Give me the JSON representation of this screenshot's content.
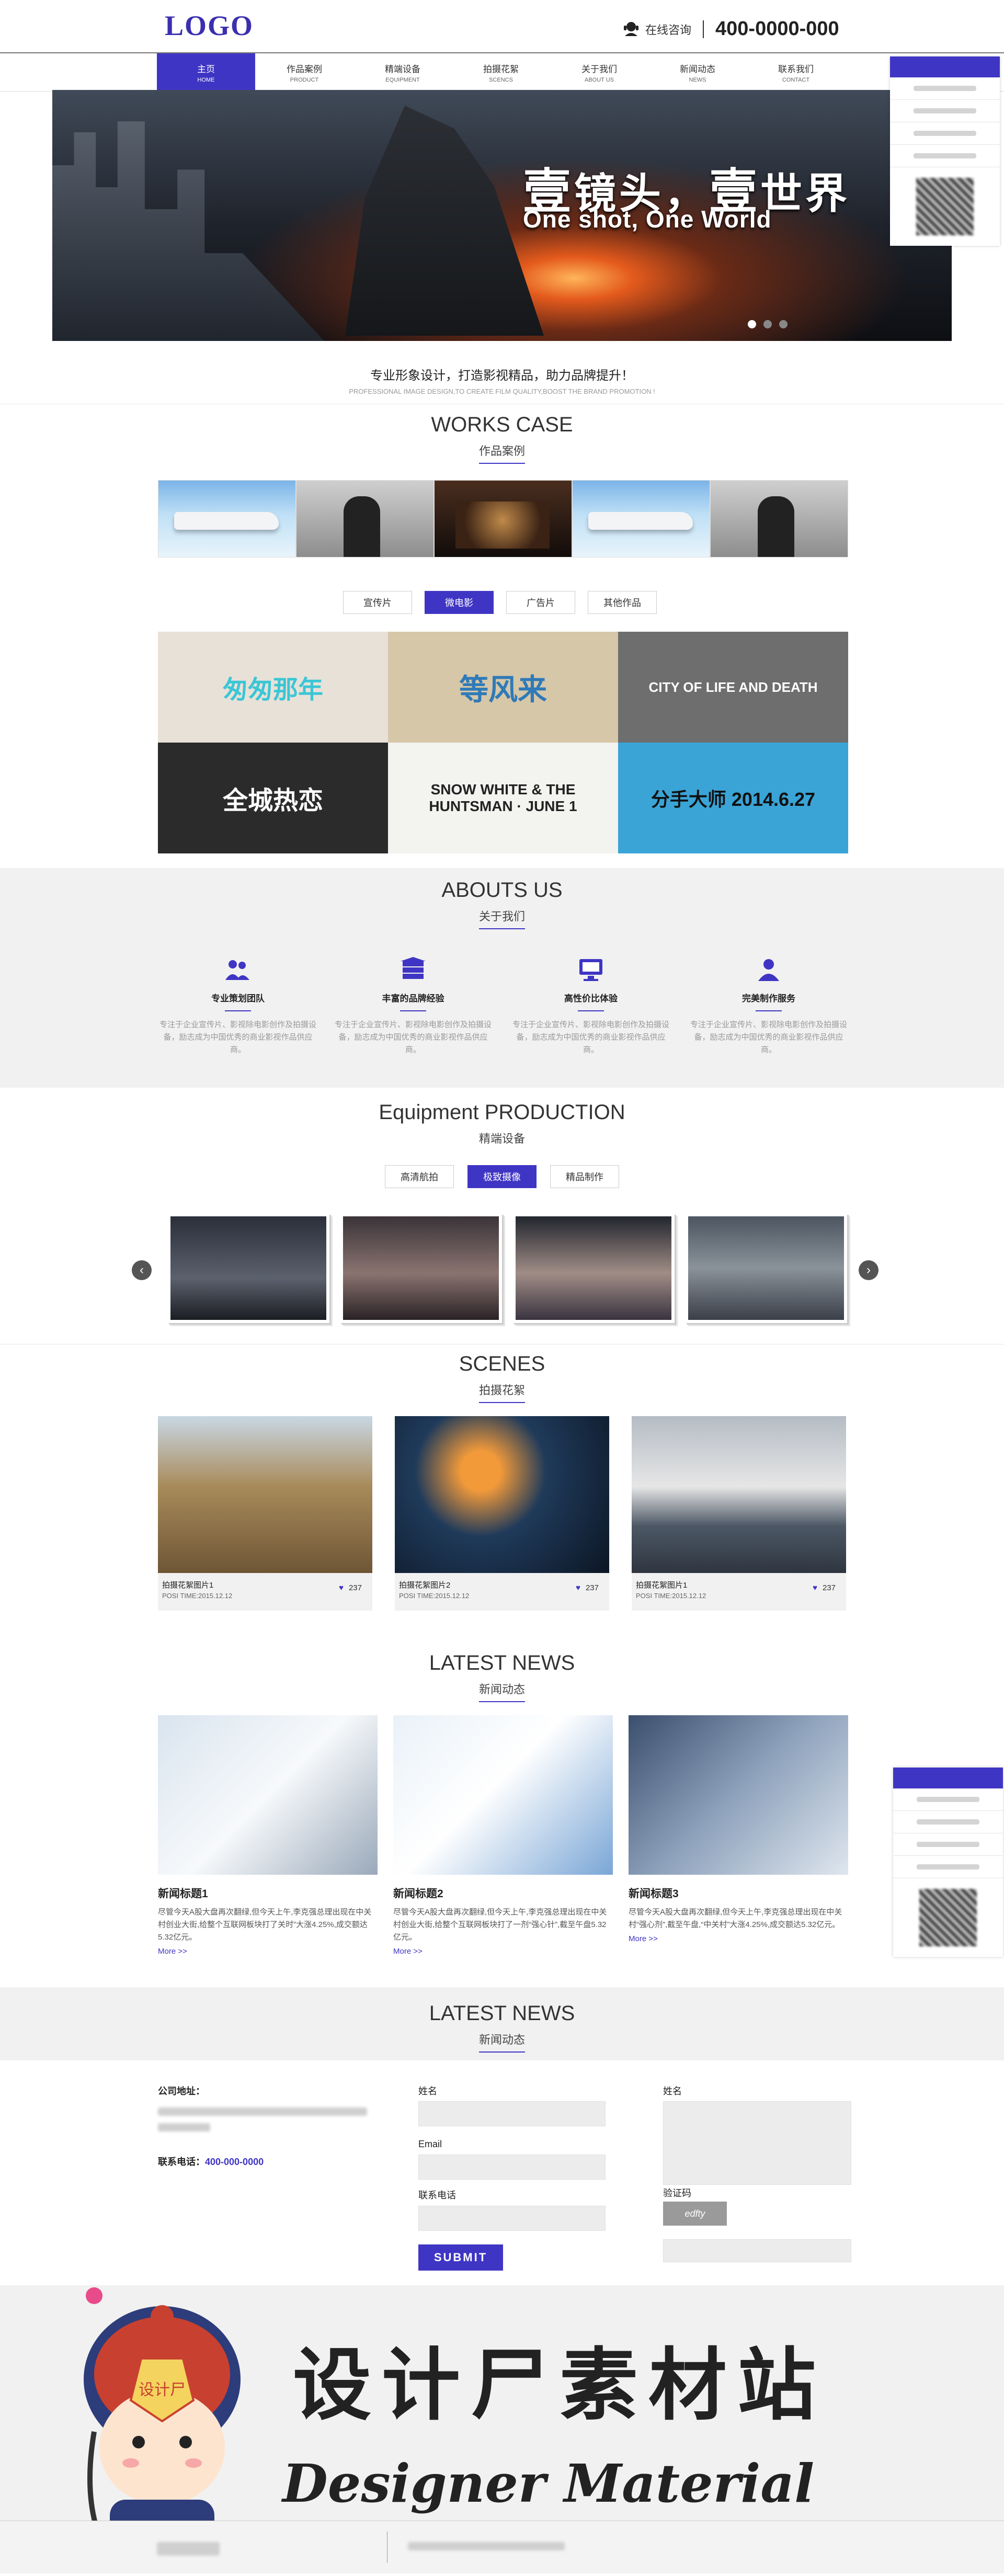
{
  "header": {
    "logo": "LOGO",
    "hotline_label": "在线咨询",
    "hotline_number": "400-0000-000"
  },
  "nav": [
    {
      "cn": "主页",
      "en": "HOME",
      "active": true
    },
    {
      "cn": "作品案例",
      "en": "PRODUCT"
    },
    {
      "cn": "精端设备",
      "en": "EQUIPMENT"
    },
    {
      "cn": "拍摄花絮",
      "en": "SCENCS"
    },
    {
      "cn": "关于我们",
      "en": "ABOUT US"
    },
    {
      "cn": "新闻动态",
      "en": "NEWS"
    },
    {
      "cn": "联系我们",
      "en": "CONTACT"
    }
  ],
  "banner": {
    "title_cn_a": "壹",
    "title_cn_b": "镜头，",
    "title_cn_c": "壹",
    "title_cn_d": "世界",
    "title_en": "One shot, One World"
  },
  "slogan": {
    "cn": "专业形象设计，打造影视精品，助力品牌提升！",
    "en": "PROFESSIONAL IMAGE DESIGN,TO CREATE FILM QUALITY,BOOST THE BRAND PROMOTION !"
  },
  "works": {
    "title": "WORKS CASE",
    "subtitle": "作品案例",
    "filters": [
      "宣传片",
      "微电影",
      "广告片",
      "其他作品"
    ],
    "active_filter": 1,
    "posters": [
      {
        "text": "匆匆那年",
        "bg": "#e8e1d8",
        "fg": "#3ac6d6"
      },
      {
        "text": "等风来",
        "bg": "#d6c7a8",
        "fg": "#2f7ab8"
      },
      {
        "text": "CITY OF LIFE AND DEATH",
        "bg": "#6e6e6e",
        "fg": "#ffffff"
      },
      {
        "text": "全城热恋",
        "bg": "#2b2b2b",
        "fg": "#ffffff"
      },
      {
        "text": "SNOW WHITE & THE HUNTSMAN · JUNE 1",
        "bg": "#f3f3f0",
        "fg": "#222222"
      },
      {
        "text": "分手大师 2014.6.27",
        "bg": "#3aa4d6",
        "fg": "#111111"
      }
    ]
  },
  "about": {
    "title": "ABOUTS US",
    "subtitle": "关于我们",
    "items": [
      {
        "title": "专业策划团队",
        "desc": "专注于企业宣传片、影视除电影创作及拍摄设备，励志成为中国优秀的商业影视作品供应商。"
      },
      {
        "title": "丰富的品牌经验",
        "desc": "专注于企业宣传片、影视除电影创作及拍摄设备，励志成为中国优秀的商业影视作品供应商。"
      },
      {
        "title": "高性价比体验",
        "desc": "专注于企业宣传片、影视除电影创作及拍摄设备，励志成为中国优秀的商业影视作品供应商。"
      },
      {
        "title": "完美制作服务",
        "desc": "专注于企业宣传片、影视除电影创作及拍摄设备，励志成为中国优秀的商业影视作品供应商。"
      }
    ]
  },
  "equipment": {
    "title": "Equipment PRODUCTION",
    "subtitle": "精端设备",
    "tabs": [
      "高清航拍",
      "极致摄像",
      "精品制作"
    ],
    "active_tab": 1,
    "prev": "‹",
    "next": "›"
  },
  "scenes": {
    "title": "SCENES",
    "subtitle": "拍摄花絮",
    "items": [
      {
        "caption": "拍摄花絮图片1",
        "time": "POSI TIME:2015.12.12",
        "likes": "237"
      },
      {
        "caption": "拍摄花絮图片2",
        "time": "POSI TIME:2015.12.12",
        "likes": "237"
      },
      {
        "caption": "拍摄花絮图片1",
        "time": "POSI TIME:2015.12.12",
        "likes": "237"
      }
    ],
    "heart": "♥"
  },
  "news": {
    "title": "LATEST NEWS",
    "subtitle": "新闻动态",
    "items": [
      {
        "title": "新闻标题1",
        "desc": "尽管今天A股大盘再次翻绿,但今天上午,李克强总理出现在中关村创业大街,给整个互联网板块打了关时”大涨4.25%,成交额达5.32亿元。",
        "more": "More >>"
      },
      {
        "title": "新闻标题2",
        "desc": "尽管今天A股大盘再次翻绿,但今天上午,李克强总理出现在中关村创业大街,给整个互联网板块打了一剂“强心针”,截至午盘5.32亿元。",
        "more": "More >>"
      },
      {
        "title": "新闻标题3",
        "desc": "尽管今天A股大盘再次翻绿,但今天上午,李克强总理出现在中关村“强心剂”,截至午盘,“中关村”大涨4.25%,成交额达5.32亿元。",
        "more": "More >>"
      }
    ]
  },
  "contact": {
    "title": "LATEST NEWS",
    "subtitle": "新闻动态",
    "address_label": "公司地址：",
    "phone_label": "联系电话：",
    "phone": "400-000-0000",
    "name_label": "姓名",
    "email_label": "Email",
    "tel_label": "联系电话",
    "msg_label": "姓名",
    "captcha_label": "验证码",
    "captcha": "edfty",
    "submit": "SUBMIT"
  },
  "watermark": {
    "cn": "设计尸素材站",
    "en": "Designer Material Station",
    "badge": "设计尸"
  },
  "colors": {
    "accent": "#3f35c4"
  }
}
